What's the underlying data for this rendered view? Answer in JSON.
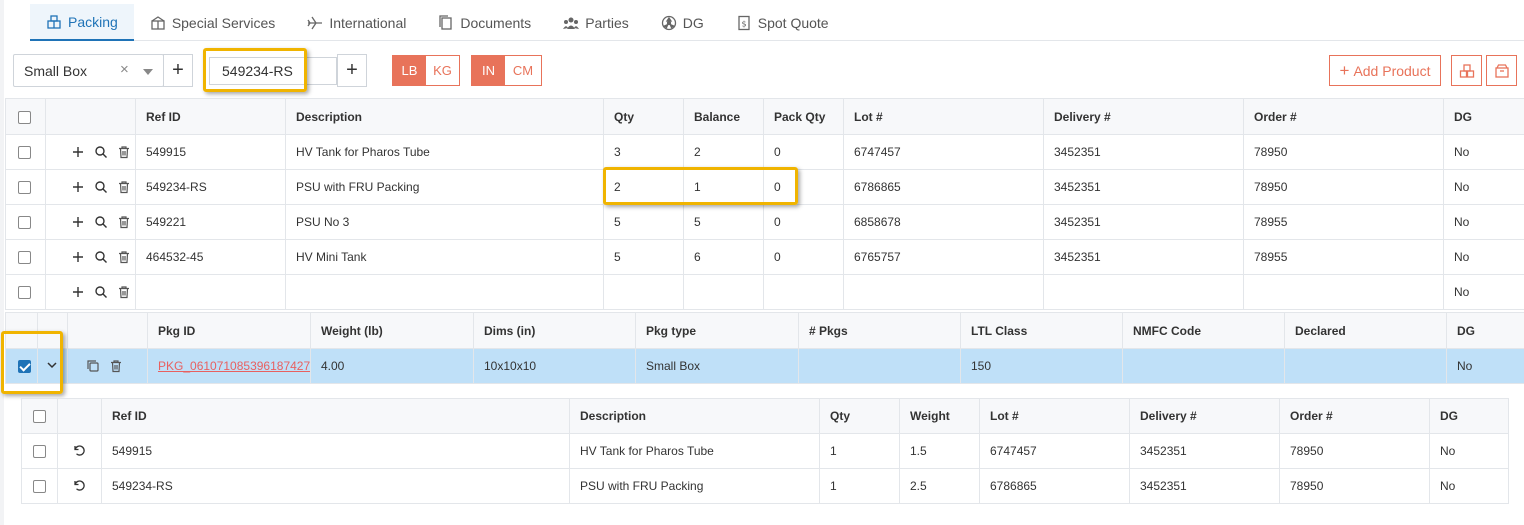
{
  "tabs": [
    {
      "label": "Packing",
      "icon": "packing-icon",
      "active": true
    },
    {
      "label": "Special Services",
      "icon": "special-services-icon"
    },
    {
      "label": "International",
      "icon": "plane-icon"
    },
    {
      "label": "Documents",
      "icon": "documents-icon"
    },
    {
      "label": "Parties",
      "icon": "parties-icon"
    },
    {
      "label": "DG",
      "icon": "hazard-icon"
    },
    {
      "label": "Spot Quote",
      "icon": "quote-icon"
    }
  ],
  "toolbar": {
    "box_type": "Small Box",
    "ref_input_value": "549234-RS",
    "weight_units": [
      "LB",
      "KG"
    ],
    "weight_unit_selected": "LB",
    "dim_units": [
      "IN",
      "CM"
    ],
    "dim_unit_selected": "IN",
    "add_product_label": "Add Product",
    "accent_color": "#e8735a"
  },
  "products": {
    "columns": [
      "Ref ID",
      "Description",
      "Qty",
      "Balance",
      "Pack Qty",
      "Lot #",
      "Delivery #",
      "Order #",
      "DG"
    ],
    "rows": [
      {
        "ref": "549915",
        "desc": "HV Tank for Pharos Tube",
        "qty": "3",
        "balance": "2",
        "pack": "0",
        "lot": "6747457",
        "delivery": "3452351",
        "order": "78950",
        "dg": "No"
      },
      {
        "ref": "549234-RS",
        "desc": "PSU with FRU Packing",
        "qty": "2",
        "balance": "1",
        "pack": "0",
        "lot": "6786865",
        "delivery": "3452351",
        "order": "78950",
        "dg": "No"
      },
      {
        "ref": "549221",
        "desc": "PSU No 3",
        "qty": "5",
        "balance": "5",
        "pack": "0",
        "lot": "6858678",
        "delivery": "3452351",
        "order": "78955",
        "dg": "No"
      },
      {
        "ref": "464532-45",
        "desc": "HV Mini Tank",
        "qty": "5",
        "balance": "6",
        "pack": "0",
        "lot": "6765757",
        "delivery": "3452351",
        "order": "78955",
        "dg": "No"
      },
      {
        "ref": "",
        "desc": "",
        "qty": "",
        "balance": "",
        "pack": "",
        "lot": "",
        "delivery": "",
        "order": "",
        "dg": "No"
      }
    ]
  },
  "packages": {
    "columns": [
      "Pkg ID",
      "Weight (lb)",
      "Dims (in)",
      "Pkg type",
      "# Pkgs",
      "LTL Class",
      "NMFC Code",
      "Declared",
      "DG"
    ],
    "rows": [
      {
        "pkg_id": "PKG_061071085396187427",
        "weight": "4.00",
        "dims": "10x10x10",
        "type": "Small Box",
        "count": "",
        "ltl": "150",
        "nmfc": "",
        "declared": "",
        "dg": "No"
      }
    ]
  },
  "package_items": {
    "columns": [
      "Ref ID",
      "Description",
      "Qty",
      "Weight",
      "Lot #",
      "Delivery #",
      "Order #",
      "DG"
    ],
    "rows": [
      {
        "ref": "549915",
        "desc": "HV Tank for Pharos Tube",
        "qty": "1",
        "weight": "1.5",
        "lot": "6747457",
        "delivery": "3452351",
        "order": "78950",
        "dg": "No"
      },
      {
        "ref": "549234-RS",
        "desc": "PSU with FRU Packing",
        "qty": "1",
        "weight": "2.5",
        "lot": "6786865",
        "delivery": "3452351",
        "order": "78950",
        "dg": "No"
      }
    ]
  }
}
